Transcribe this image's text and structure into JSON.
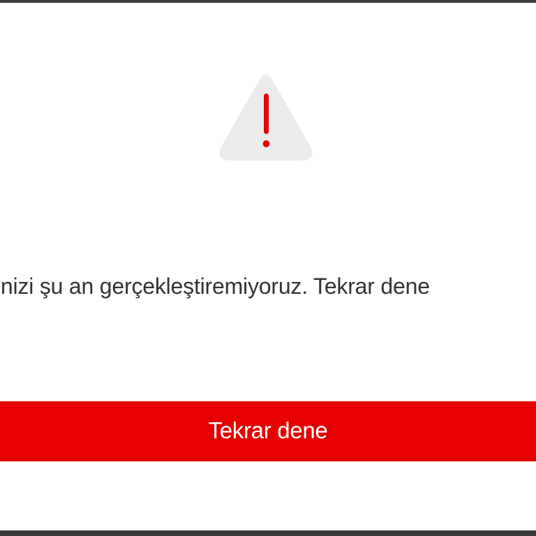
{
  "error": {
    "icon": "warning-triangle-icon",
    "message": "inizi şu an gerçekleştiremiyoruz. Tekrar dene"
  },
  "actions": {
    "retry_label": "Tekrar dene"
  },
  "colors": {
    "accent": "#e60000",
    "icon_background": "#ebebeb",
    "text": "#333333",
    "frame": "#3c3c3c"
  }
}
